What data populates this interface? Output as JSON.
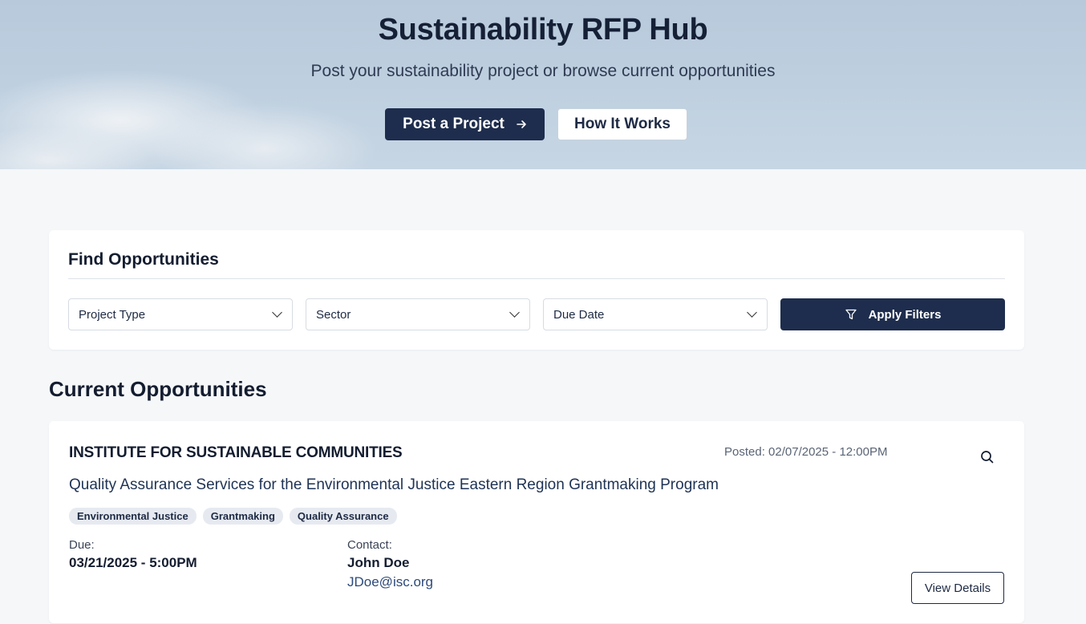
{
  "hero": {
    "title": "Sustainability RFP Hub",
    "subtitle": "Post your sustainability project or browse current opportunities",
    "primary_button": "Post a Project",
    "secondary_button": "How It Works"
  },
  "filters": {
    "title": "Find Opportunities",
    "project_type": "Project Type",
    "sector": "Sector",
    "due_date": "Due Date",
    "apply_button": "Apply Filters"
  },
  "opportunities": {
    "section_title": "Current Opportunities",
    "items": [
      {
        "organization": "INSTITUTE FOR SUSTAINABLE COMMUNITIES",
        "posted": "Posted: 02/07/2025 - 12:00PM",
        "title": "Quality Assurance Services for the Environmental Justice Eastern Region Grantmaking Program",
        "tags": [
          "Environmental Justice",
          "Grantmaking",
          "Quality Assurance"
        ],
        "due_label": "Due:",
        "due_value": "03/21/2025 - 5:00PM",
        "contact_label": "Contact:",
        "contact_name": "John Doe",
        "contact_email": "JDoe@isc.org",
        "details_button": "View Details"
      }
    ]
  },
  "icons": {
    "arrow": "arrow-right-icon",
    "chevron": "chevron-down-icon",
    "filter": "filter-icon",
    "search": "search-icon"
  },
  "colors": {
    "primary": "#1e2d4d",
    "tag_bg": "#e6eaf0",
    "page_bg": "#f5f7f9"
  }
}
